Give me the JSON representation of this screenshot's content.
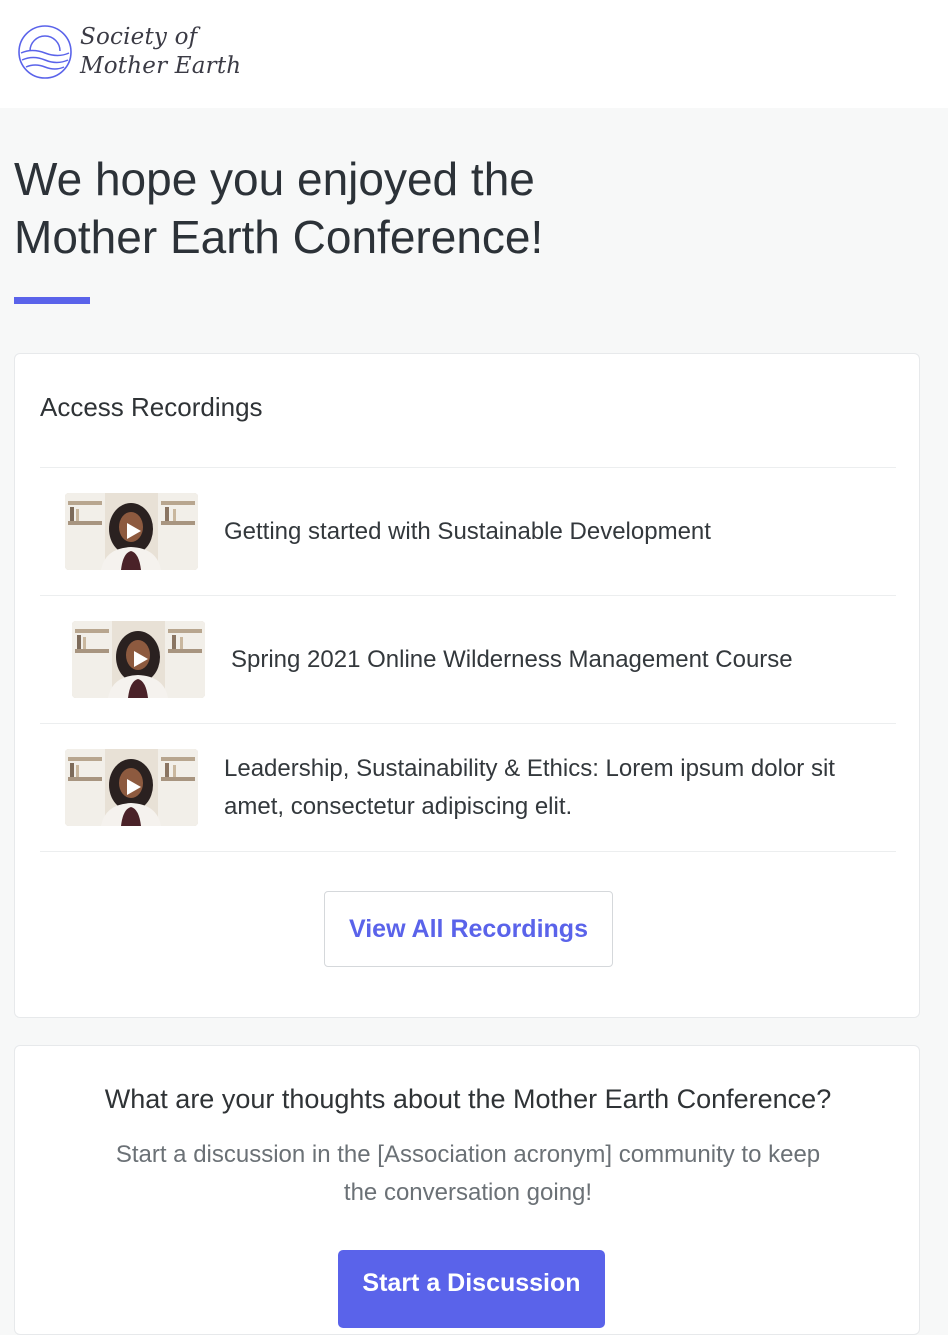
{
  "brand": {
    "logo_line1": "Society of",
    "logo_line2": "Mother Earth",
    "accent_color": "#5a63ea",
    "logo_icon": "sun-over-waves-icon"
  },
  "hero": {
    "headline_line1": "We hope you enjoyed the",
    "headline_line2": "Mother Earth Conference!"
  },
  "recordings": {
    "title": "Access Recordings",
    "items": [
      {
        "title": "Getting started with Sustainable Development",
        "thumbnail_icon": "video-play-icon"
      },
      {
        "title": "Spring 2021 Online Wilderness Management Course",
        "thumbnail_icon": "video-play-icon"
      },
      {
        "title_line1": "Leadership, Sustainability & Ethics: Lorem ipsum dolor sit",
        "title_line2": "amet, consectetur adipiscing elit.",
        "thumbnail_icon": "video-play-icon"
      }
    ],
    "view_all_label": "View All Recordings"
  },
  "discussion": {
    "title": "What are your thoughts about the Mother Earth Conference?",
    "subtitle_line1": "Start a discussion in the [Association acronym] community to keep",
    "subtitle_line2": "the conversation going!",
    "button_label": "Start a Discussion"
  }
}
